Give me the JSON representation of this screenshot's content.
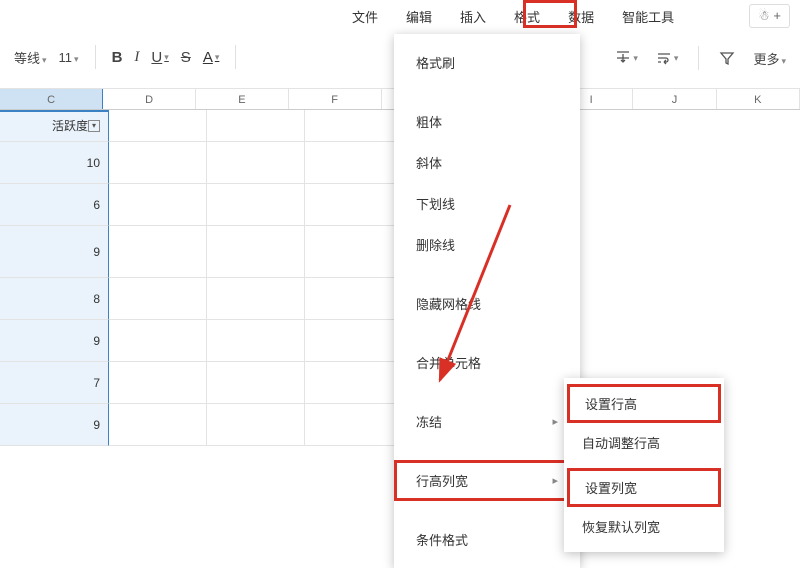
{
  "menubar": {
    "items": [
      "文件",
      "编辑",
      "插入",
      "格式",
      "数据",
      "智能工具"
    ],
    "adduser": "+"
  },
  "toolbar": {
    "line_style": "等线",
    "font_size": "11",
    "more": "更多"
  },
  "col_headers": [
    "C",
    "D",
    "E",
    "F",
    "I",
    "J",
    "K"
  ],
  "column_c": {
    "header": "活跃度",
    "values": [
      "10",
      "6",
      "9",
      "8",
      "9",
      "7",
      "9"
    ]
  },
  "format_menu": {
    "items": [
      "格式刷",
      "粗体",
      "斜体",
      "下划线",
      "删除线",
      "隐藏网格线",
      "合并单元格",
      "冻结",
      "行高列宽",
      "条件格式"
    ]
  },
  "submenu": {
    "items": [
      "设置行高",
      "自动调整行高",
      "设置列宽",
      "恢复默认列宽"
    ]
  }
}
